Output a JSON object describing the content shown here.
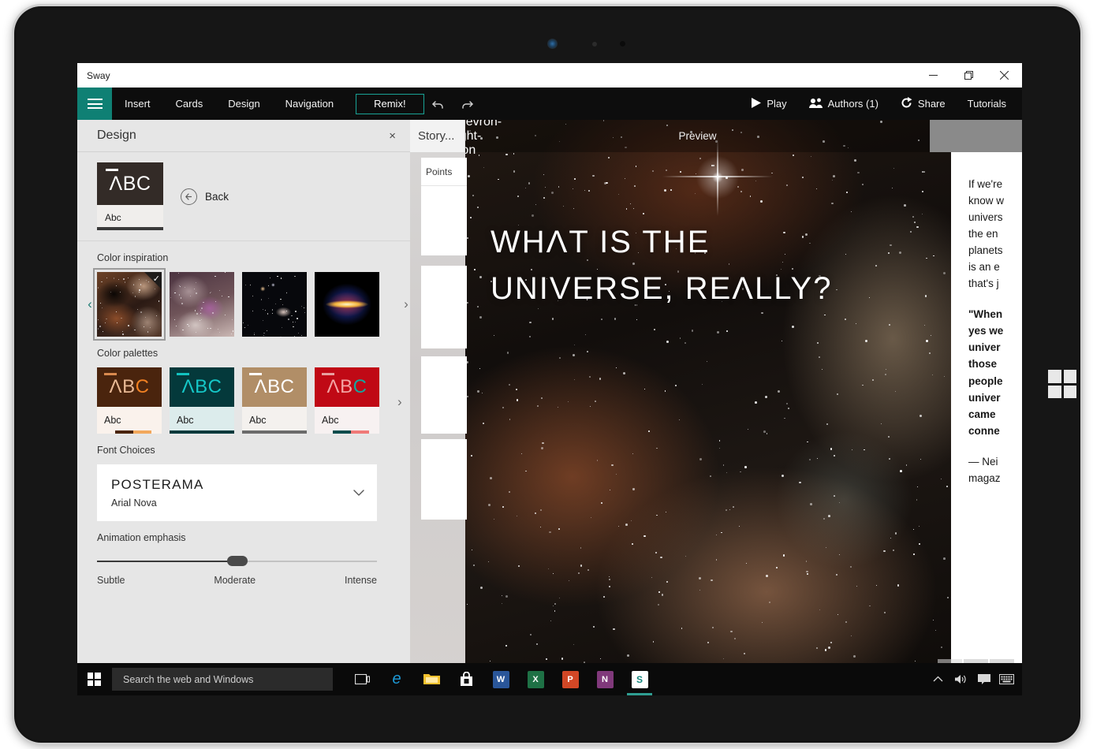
{
  "window": {
    "app_title": "Sway",
    "controls": {
      "minimize": "minimize-icon",
      "restore": "restore-icon",
      "close": "close-icon"
    }
  },
  "ribbon": {
    "menu_icon": "hamburger-menu-icon",
    "items": [
      "Insert",
      "Cards",
      "Design",
      "Navigation"
    ],
    "remix_label": "Remix!",
    "undo_icon": "undo-icon",
    "redo_icon": "redo-icon",
    "right_items": [
      {
        "label": "Play",
        "icon": "play-icon"
      },
      {
        "label": "Authors (1)",
        "icon": "people-icon"
      },
      {
        "label": "Share",
        "icon": "share-icon"
      },
      {
        "label": "Tutorials",
        "icon": ""
      }
    ]
  },
  "design_panel": {
    "title": "Design",
    "close_label": "×",
    "back_label": "Back",
    "current_style": {
      "abc_label": "ΛBC",
      "abc_small": "Abc",
      "bg": "#332b27",
      "fg": "#ffffff",
      "bottom_bg": "#f0eeec",
      "bottom_fg": "#1c1c1c",
      "underline": [
        "#3a3a3a"
      ]
    },
    "color_inspiration": {
      "label": "Color inspiration",
      "prev_arrow": "‹",
      "next_arrow": "›",
      "thumbs": [
        {
          "name": "nebula-thumb-1",
          "selected": true
        },
        {
          "name": "nebula-thumb-2",
          "selected": false
        },
        {
          "name": "galaxy-thumb-3",
          "selected": false
        },
        {
          "name": "allsky-thumb-4",
          "selected": false
        }
      ]
    },
    "color_palettes": {
      "label": "Color palettes",
      "next_arrow": "›",
      "items": [
        {
          "abc": "ΛBC",
          "abc_small": "Abc",
          "bg": "#4a240d",
          "fg": "#e8b894",
          "accent": "#f08022",
          "bar": "#d98a4e",
          "bottom_bg": "#faf2ec",
          "bottom_fg": "#1c1c1c",
          "underline": [
            "#4a240d",
            "#f2a85c"
          ]
        },
        {
          "abc": "ΛBC",
          "abc_small": "Abc",
          "bg": "#04393b",
          "fg": "#15c7c7",
          "accent": "#15c7c7",
          "bar": "#12c2bf",
          "bottom_bg": "#dcecec",
          "bottom_fg": "#1c1c1c",
          "underline": [
            "#04393b"
          ]
        },
        {
          "abc": "ΛBC",
          "abc_small": "Abc",
          "bg": "#b18e67",
          "fg": "#ffffff",
          "accent": "#ffffff",
          "bar": "#ffffff",
          "bottom_bg": "#f4f1ee",
          "bottom_fg": "#1c1c1c",
          "underline": [
            "#6b6b6b"
          ]
        },
        {
          "abc": "ΛBC",
          "abc_small": "Abc",
          "bg": "#c00915",
          "fg": "#f3a3a3",
          "accent": "#13a7a0",
          "bar": "#e8a0a0",
          "bottom_bg": "#f7f1f1",
          "bottom_fg": "#1c1c1c",
          "underline": [
            "#0c4c4c",
            "#f07a78"
          ]
        }
      ]
    },
    "font_choices": {
      "label": "Font Choices",
      "primary": "POSTERAMA",
      "secondary": "Arial Nova",
      "chevron": "chevron-down-icon"
    },
    "animation_emphasis": {
      "label": "Animation emphasis",
      "min_label": "Subtle",
      "value_label": "Moderate",
      "max_label": "Intense",
      "value_percent": 50
    }
  },
  "storyline": {
    "tab_label": "Story...",
    "card_header_label": "Points"
  },
  "preview": {
    "expand_icon": "chevron-right-icon",
    "label": "Preview",
    "hero_title_lines": [
      "WHΛT IS THE",
      "UNIVERSE, REΛLLY?"
    ],
    "body_lines": [
      "If we're",
      "know w",
      "univers",
      "the en",
      "planets",
      "is an e",
      "that's j"
    ],
    "quote_lines": [
      "\"When",
      "yes we",
      "univer",
      "those",
      "people",
      "univer",
      "came",
      "conne"
    ],
    "attribution_lines": [
      "— Nei",
      "magaz"
    ],
    "pager": {
      "first": "⏮",
      "prev": "‹",
      "next": "›"
    }
  },
  "taskbar": {
    "start_icon": "windows-start-icon",
    "search_placeholder": "Search the web and Windows",
    "apps": [
      {
        "name": "task-view-icon",
        "glyph": "❑",
        "bg": "transparent",
        "fg": "#e0e0e0"
      },
      {
        "name": "edge-icon",
        "glyph": "e",
        "bg": "transparent",
        "fg": "#1d9bd8"
      },
      {
        "name": "file-explorer-icon",
        "glyph": "",
        "bg": "#f5c12e",
        "fg": "#1c1c1c"
      },
      {
        "name": "store-icon",
        "glyph": "",
        "bg": "#ffffff",
        "fg": "#1c1c1c"
      },
      {
        "name": "word-icon",
        "glyph": "W",
        "bg": "#2a5699",
        "fg": "#ffffff"
      },
      {
        "name": "excel-icon",
        "glyph": "X",
        "bg": "#1e7145",
        "fg": "#ffffff"
      },
      {
        "name": "powerpoint-icon",
        "glyph": "P",
        "bg": "#d24726",
        "fg": "#ffffff"
      },
      {
        "name": "onenote-icon",
        "glyph": "N",
        "bg": "#80397b",
        "fg": "#ffffff"
      },
      {
        "name": "sway-icon",
        "glyph": "S",
        "bg": "#ffffff",
        "fg": "#12857c",
        "active": true
      }
    ],
    "tray": [
      {
        "name": "show-hidden-icons-chevron",
        "glyph": "∧"
      },
      {
        "name": "volume-icon",
        "glyph": "🔊"
      },
      {
        "name": "action-center-icon",
        "glyph": "💬"
      },
      {
        "name": "touch-keyboard-icon",
        "glyph": "⌨"
      }
    ]
  }
}
